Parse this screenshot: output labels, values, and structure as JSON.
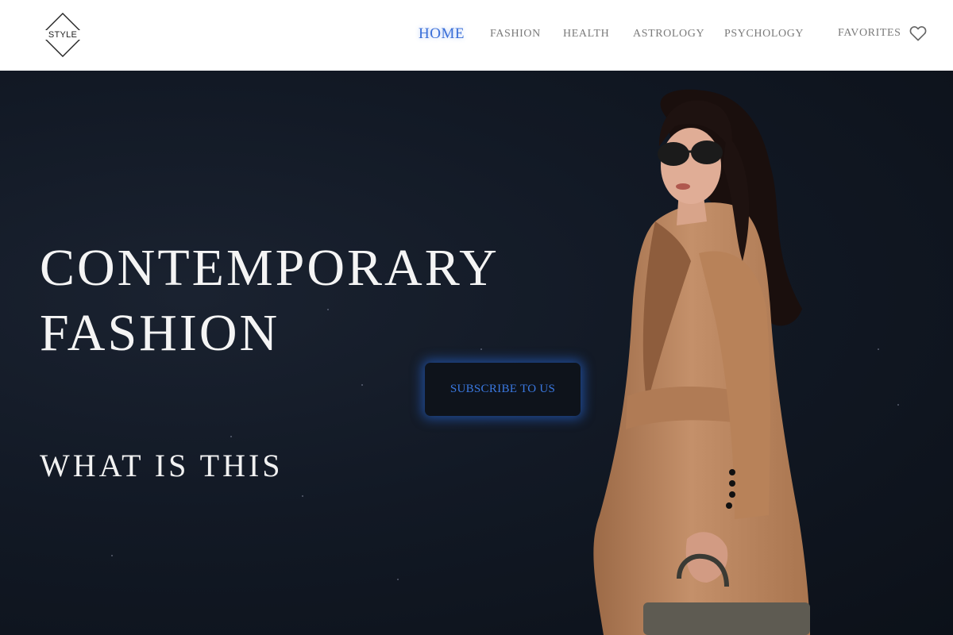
{
  "header": {
    "logo_text": "STYLE",
    "nav": [
      {
        "label": "HOME",
        "active": true
      },
      {
        "label": "FASHION",
        "active": false
      },
      {
        "label": "HEALTH",
        "active": false
      },
      {
        "label": "ASTROLOGY",
        "active": false
      },
      {
        "label": "PSYCHOLOGY",
        "active": false
      }
    ],
    "favorites_label": "FAVORITES",
    "favorites_icon": "heart-outline-icon"
  },
  "hero": {
    "title_line1": "CONTEMPORARY",
    "title_line2": "FASHION",
    "subtitle": "WHAT IS THIS",
    "subscribe_label": "SUBSCRIBE TO US",
    "image": "woman-in-camel-coat-with-sunglasses-and-handbag"
  },
  "colors": {
    "accent": "#3a6fd8",
    "hero_bg": "#121925",
    "nav_text": "#7a7a7a",
    "coat": "#c08a62"
  }
}
